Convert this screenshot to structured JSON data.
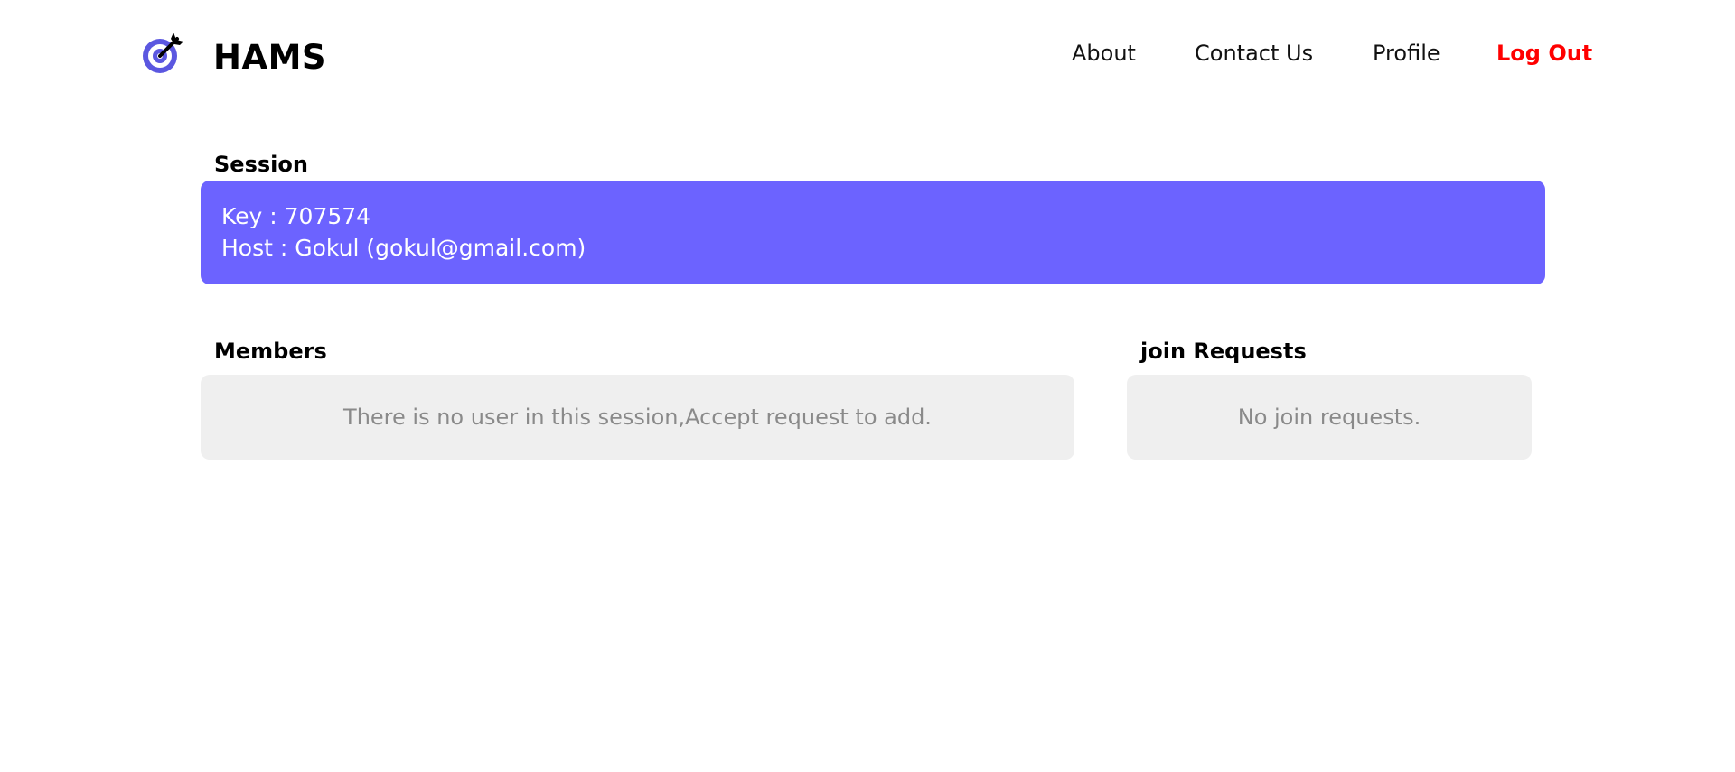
{
  "brand": {
    "name": "HAMS",
    "logo_icon": "dartboard-target-icon",
    "logo_colors": {
      "ring": "#5b57e0",
      "dart": "#000000"
    }
  },
  "nav": {
    "about": "About",
    "contact": "Contact Us",
    "profile": "Profile",
    "logout": "Log Out",
    "logout_color": "#ff0000"
  },
  "session": {
    "title": "Session",
    "key_line": "Key : 707574",
    "host_line": "Host : Gokul (gokul@gmail.com)",
    "card_color": "#6c63ff"
  },
  "members": {
    "title": "Members",
    "empty_message": "There is no user in this session,Accept request to add."
  },
  "join_requests": {
    "title": "join Requests",
    "empty_message": "No join requests."
  }
}
